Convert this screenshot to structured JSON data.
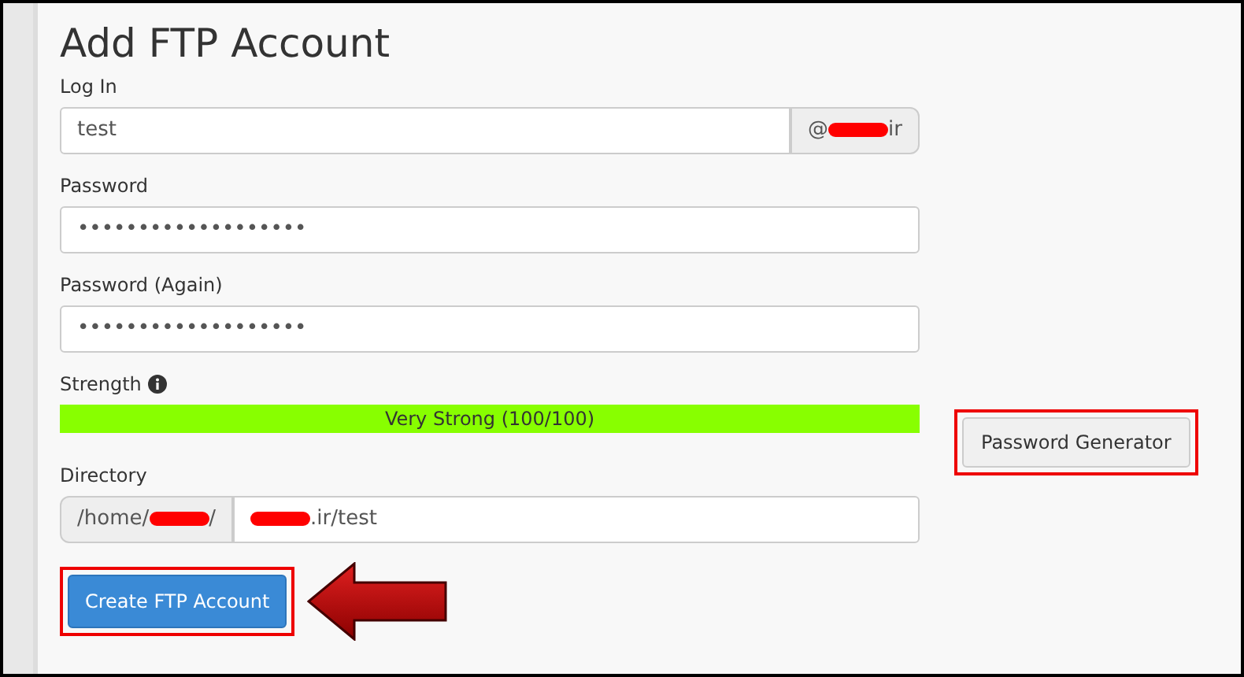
{
  "title": "Add FTP Account",
  "login": {
    "label": "Log In",
    "value": "test",
    "suffix_before": "@",
    "suffix_after": "ir",
    "redacted": true
  },
  "password": {
    "label": "Password",
    "value": "•••••••••••••••••••"
  },
  "password_again": {
    "label": "Password (Again)",
    "value": "•••••••••••••••••••"
  },
  "strength": {
    "label": "Strength",
    "info_icon": true,
    "level": 1,
    "color": "#88ff00",
    "reading": "Very Strong (100/100)"
  },
  "generator_button": {
    "label": "Password Generator",
    "highlighted": true
  },
  "directory": {
    "label": "Directory",
    "prefix_before": "/home/",
    "prefix_after": "/",
    "value_after": ".ir/test",
    "redacted": true
  },
  "submit_button": {
    "label": "Create FTP Account",
    "highlighted": true,
    "arrow": true
  }
}
